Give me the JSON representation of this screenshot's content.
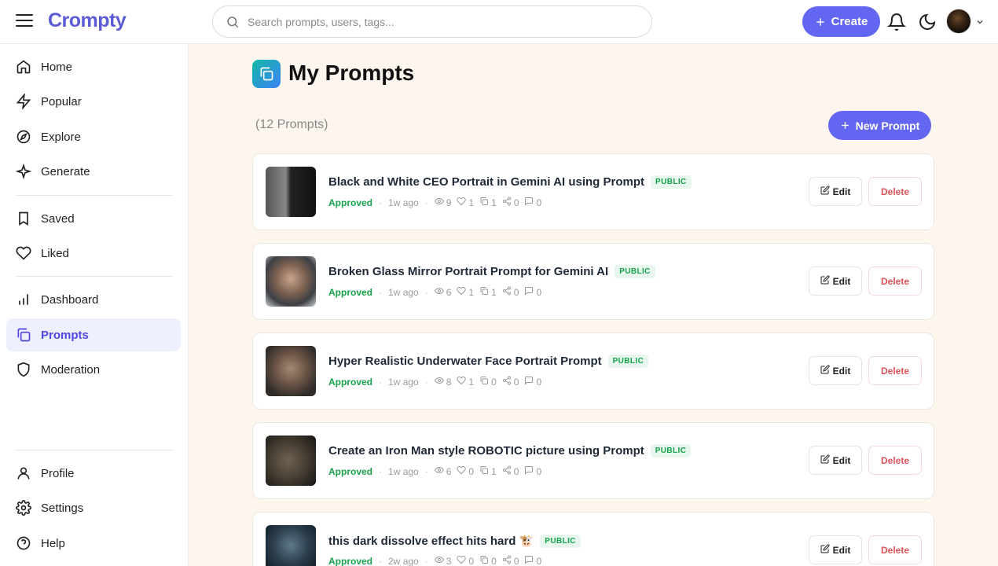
{
  "app": {
    "logo": "Crompty"
  },
  "header": {
    "search_placeholder": "Search prompts, users, tags...",
    "create_label": "Create"
  },
  "sidebar": {
    "items": [
      {
        "label": "Home",
        "icon": "home-icon"
      },
      {
        "label": "Popular",
        "icon": "bolt-icon"
      },
      {
        "label": "Explore",
        "icon": "compass-icon"
      },
      {
        "label": "Generate",
        "icon": "sparkle-icon"
      },
      {
        "label": "Saved",
        "icon": "bookmark-icon"
      },
      {
        "label": "Liked",
        "icon": "heart-icon"
      },
      {
        "label": "Dashboard",
        "icon": "bar-chart-icon"
      },
      {
        "label": "Prompts",
        "icon": "copy-icon",
        "active": true
      },
      {
        "label": "Moderation",
        "icon": "shield-icon"
      },
      {
        "label": "Profile",
        "icon": "user-icon"
      },
      {
        "label": "Settings",
        "icon": "gear-icon"
      },
      {
        "label": "Help",
        "icon": "help-icon"
      }
    ]
  },
  "main": {
    "title": "My Prompts",
    "count": "(12 Prompts)",
    "new_prompt_label": "New Prompt",
    "prompts": [
      {
        "title": "Black and White CEO Portrait in Gemini AI using Prompt",
        "badge": "PUBLIC",
        "status": "Approved",
        "time": "1w ago",
        "views": "9",
        "likes": "1",
        "copies": "1",
        "shares": "0",
        "comments": "0"
      },
      {
        "title": "Broken Glass Mirror Portrait Prompt for Gemini AI",
        "badge": "PUBLIC",
        "status": "Approved",
        "time": "1w ago",
        "views": "6",
        "likes": "1",
        "copies": "1",
        "shares": "0",
        "comments": "0"
      },
      {
        "title": "Hyper Realistic Underwater Face Portrait Prompt",
        "badge": "PUBLIC",
        "status": "Approved",
        "time": "1w ago",
        "views": "8",
        "likes": "1",
        "copies": "0",
        "shares": "0",
        "comments": "0"
      },
      {
        "title": "Create an Iron Man style ROBOTIC picture using Prompt",
        "badge": "PUBLIC",
        "status": "Approved",
        "time": "1w ago",
        "views": "6",
        "likes": "0",
        "copies": "1",
        "shares": "0",
        "comments": "0"
      },
      {
        "title": "this dark dissolve effect hits hard 🐮",
        "badge": "PUBLIC",
        "status": "Approved",
        "time": "2w ago",
        "views": "3",
        "likes": "0",
        "copies": "0",
        "shares": "0",
        "comments": "0"
      }
    ],
    "edit_label": "Edit",
    "delete_label": "Delete"
  },
  "colors": {
    "accent": "#6366f1",
    "status_green": "#16a34a",
    "delete_red": "#e0525a",
    "background": "#fdf6ee"
  }
}
